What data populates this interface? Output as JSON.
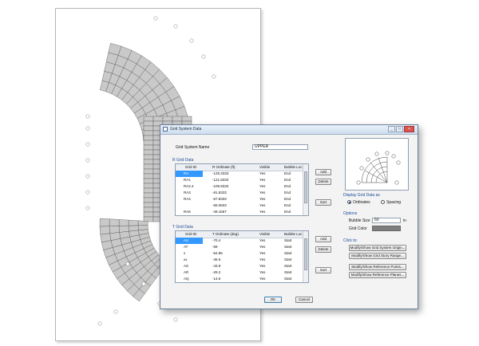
{
  "dialog": {
    "title": "Grid System Data",
    "grid_system_name_label": "Grid System Name",
    "grid_system_name_value": "UPPER"
  },
  "r_grid": {
    "header": "R Grid Data",
    "columns": [
      "Grid ID",
      "R Ordinate (ft)",
      "Visible",
      "Bubble Loc"
    ],
    "rows": [
      [
        "RA",
        "-129.3333",
        "Yes",
        "End"
      ],
      [
        "RA1",
        "-121.8333",
        "Yes",
        "End"
      ],
      [
        "RA2.4",
        "-109.8333",
        "Yes",
        "End"
      ],
      [
        "RA3",
        "-81.8333",
        "Yes",
        "End"
      ],
      [
        "RA4",
        "-67.8333",
        "Yes",
        "End"
      ],
      [
        "",
        "-65.0833",
        "Yes",
        "End"
      ],
      [
        "RA6",
        "-49.1667",
        "Yes",
        "End"
      ]
    ],
    "add_label": "Add",
    "delete_label": "Delete",
    "sort_label": "Sort"
  },
  "t_grid": {
    "header": "T Grid Data",
    "columns": [
      "Grid ID",
      "T Ordinate (deg)",
      "Visible",
      "Bubble Loc"
    ],
    "rows": [
      [
        "AU",
        "-70.4",
        "Yes",
        "Start"
      ],
      [
        "AT",
        "-59",
        "Yes",
        "Start"
      ],
      [
        "x",
        "-54.85",
        "Yes",
        "Start"
      ],
      [
        "xx",
        "-46.6",
        "Yes",
        "Start"
      ],
      [
        "AS",
        "-43.8",
        "Yes",
        "Start"
      ],
      [
        "AR",
        "-29.2",
        "Yes",
        "Start"
      ],
      [
        "AQ",
        "-14.6",
        "Yes",
        "Start"
      ]
    ],
    "add_label": "Add",
    "delete_label": "Delete",
    "sort_label": "Sort"
  },
  "display": {
    "header": "Display Grid Data as",
    "ordinates_label": "Ordinates",
    "spacing_label": "Spacing",
    "selected": "Ordinates"
  },
  "options": {
    "header": "Options",
    "bubble_size_label": "Bubble Size",
    "bubble_size_value": "60",
    "bubble_size_unit": "in",
    "grid_color_label": "Grid Color",
    "grid_color": "#7f7f7f"
  },
  "click_to": {
    "header": "Click to:",
    "buttons": [
      "Modify/Show Grid System Origin...",
      "Modify/Show Grid Story Range...",
      "Modify/Show Reference Points...",
      "Modify/Show Reference Planes..."
    ]
  },
  "footer": {
    "ok_label": "OK",
    "cancel_label": "Cancel"
  },
  "colors": {
    "accent": "#1b4a9c",
    "selection": "#3399ff"
  }
}
